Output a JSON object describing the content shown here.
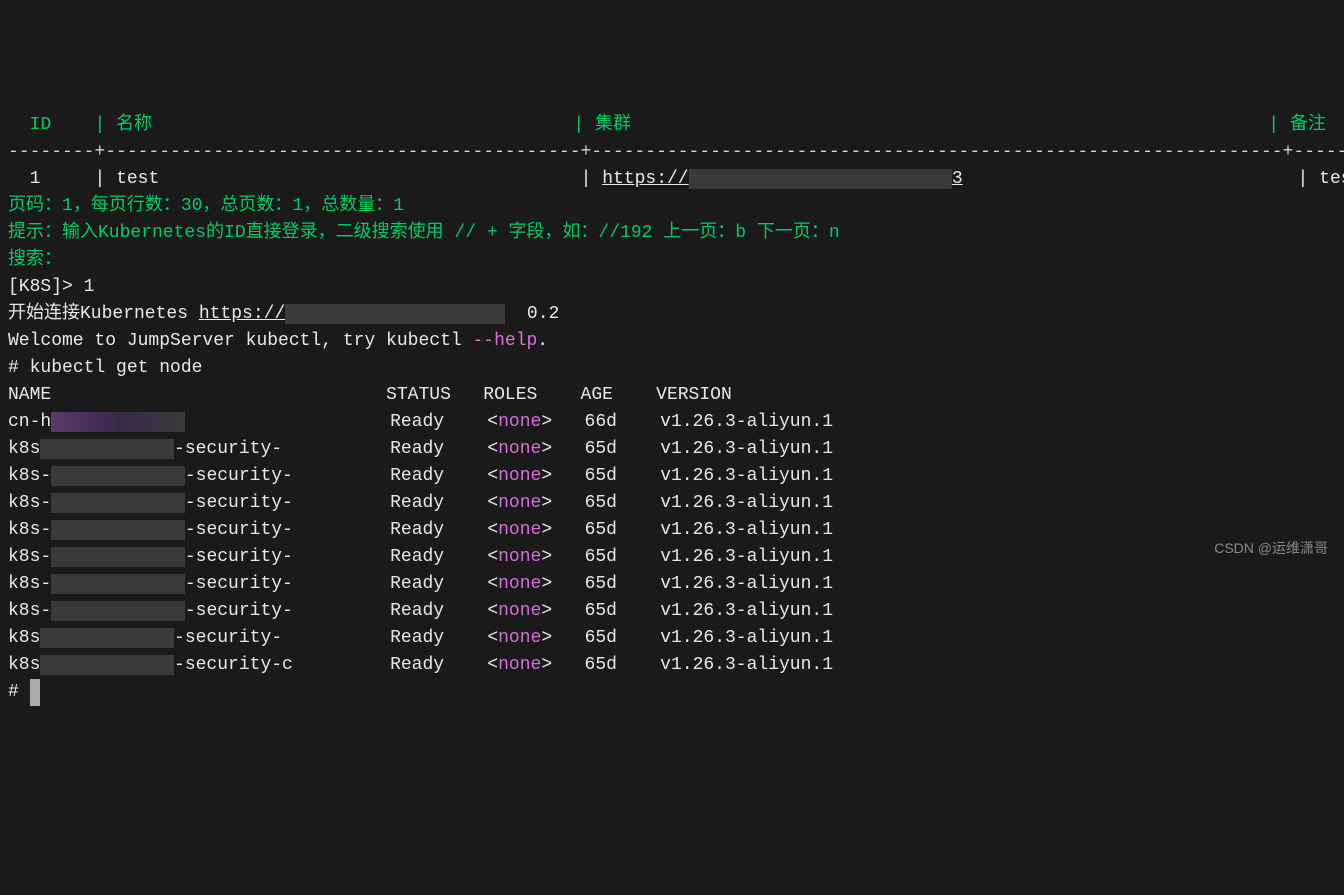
{
  "table": {
    "headers": {
      "id": "ID",
      "name": "名称",
      "cluster": "集群",
      "remark": "备注"
    },
    "row": {
      "id": "1",
      "name": "test",
      "cluster_prefix": "https://",
      "cluster_suffix": "3",
      "remark": "test"
    }
  },
  "pagination": {
    "page_label": "页码：",
    "page": "1",
    "per_page_label": "，每页行数：",
    "per_page": "30",
    "total_pages_label": "，总页数：",
    "total_pages": "1",
    "total_count_label": "，总数量：",
    "total_count": "1"
  },
  "hint": {
    "label": "提示：",
    "text": "输入Kubernetes的ID直接登录，二级搜索使用 // + 字段，如：//192 上一页：b 下一页：n"
  },
  "search": {
    "label": "搜索："
  },
  "prompt": {
    "shell": "[K8S]> ",
    "input": "1"
  },
  "connecting": {
    "prefix": "开始连接Kubernetes ",
    "url": "https://",
    "suffix": "0.2"
  },
  "welcome": {
    "prefix": "Welcome to JumpServer kubectl, try kubectl ",
    "flag": "--help",
    "suffix": "."
  },
  "command": {
    "prompt": "# ",
    "text": "kubectl get node"
  },
  "node_table": {
    "headers": {
      "name": "NAME",
      "status": "STATUS",
      "roles": "ROLES",
      "age": "AGE",
      "version": "VERSION"
    },
    "rows": [
      {
        "name_prefix": "cn-h",
        "name_mid": "",
        "status": "Ready",
        "role_open": "<",
        "role": "none",
        "role_close": ">",
        "age": "66d",
        "version": "v1.26.3-aliyun.1",
        "smudge_class": "smudge-purple"
      },
      {
        "name_prefix": "k8s",
        "name_mid": "-security-",
        "status": "Ready",
        "role_open": "<",
        "role": "none",
        "role_close": ">",
        "age": "65d",
        "version": "v1.26.3-aliyun.1",
        "smudge_class": "smudge"
      },
      {
        "name_prefix": "k8s-",
        "name_mid": "-security-",
        "status": "Ready",
        "role_open": "<",
        "role": "none",
        "role_close": ">",
        "age": "65d",
        "version": "v1.26.3-aliyun.1",
        "smudge_class": "smudge"
      },
      {
        "name_prefix": "k8s-",
        "name_mid": "-security-",
        "status": "Ready",
        "role_open": "<",
        "role": "none",
        "role_close": ">",
        "age": "65d",
        "version": "v1.26.3-aliyun.1",
        "smudge_class": "smudge"
      },
      {
        "name_prefix": "k8s-",
        "name_mid": "-security-",
        "status": "Ready",
        "role_open": "<",
        "role": "none",
        "role_close": ">",
        "age": "65d",
        "version": "v1.26.3-aliyun.1",
        "smudge_class": "smudge"
      },
      {
        "name_prefix": "k8s-",
        "name_mid": "-security-",
        "status": "Ready",
        "role_open": "<",
        "role": "none",
        "role_close": ">",
        "age": "65d",
        "version": "v1.26.3-aliyun.1",
        "smudge_class": "smudge"
      },
      {
        "name_prefix": "k8s-",
        "name_mid": "-security-",
        "status": "Ready",
        "role_open": "<",
        "role": "none",
        "role_close": ">",
        "age": "65d",
        "version": "v1.26.3-aliyun.1",
        "smudge_class": "smudge"
      },
      {
        "name_prefix": "k8s-",
        "name_mid": "-security-",
        "status": "Ready",
        "role_open": "<",
        "role": "none",
        "role_close": ">",
        "age": "65d",
        "version": "v1.26.3-aliyun.1",
        "smudge_class": "smudge"
      },
      {
        "name_prefix": "k8s",
        "name_mid": "-security-",
        "status": "Ready",
        "role_open": "<",
        "role": "none",
        "role_close": ">",
        "age": "65d",
        "version": "v1.26.3-aliyun.1",
        "smudge_class": "smudge"
      },
      {
        "name_prefix": "k8s",
        "name_mid": "-security-c",
        "status": "Ready",
        "role_open": "<",
        "role": "none",
        "role_close": ">",
        "age": "65d",
        "version": "v1.26.3-aliyun.1",
        "smudge_class": "smudge"
      }
    ]
  },
  "final_prompt": "# ",
  "watermark": "CSDN @运维潇哥"
}
